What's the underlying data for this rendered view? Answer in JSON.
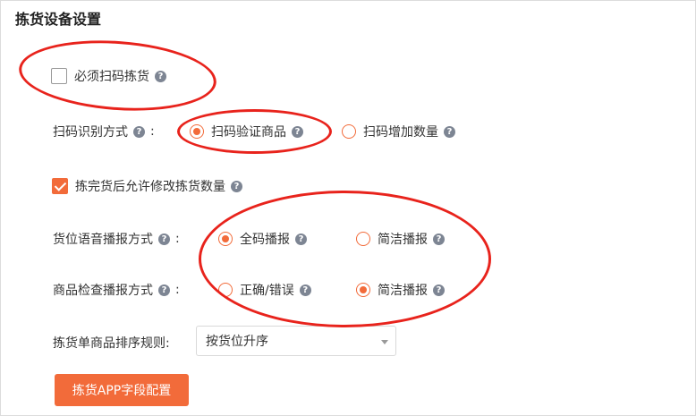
{
  "title": "拣货设备设置",
  "must_scan": {
    "label": "必须扫码拣货",
    "checked": false
  },
  "scan_mode": {
    "label": "扫码识别方式",
    "options": [
      "扫码验证商品",
      "扫码增加数量"
    ],
    "selected": "扫码验证商品"
  },
  "allow_modify": {
    "label": "拣完货后允许修改拣货数量",
    "checked": true
  },
  "location_voice": {
    "label": "货位语音播报方式",
    "options": [
      "全码播报",
      "简洁播报"
    ],
    "selected": "全码播报"
  },
  "check_voice": {
    "label": "商品检查播报方式",
    "options": [
      "正确/错误",
      "简洁播报"
    ],
    "selected": "简洁播报"
  },
  "sort_rule": {
    "label": "拣货单商品排序规则:",
    "value": "按货位升序"
  },
  "app_button": "拣货APP字段配置",
  "help_glyph": "?",
  "colon": ":",
  "colors": {
    "accent": "#f26b3a",
    "annotation": "#e8231c"
  }
}
